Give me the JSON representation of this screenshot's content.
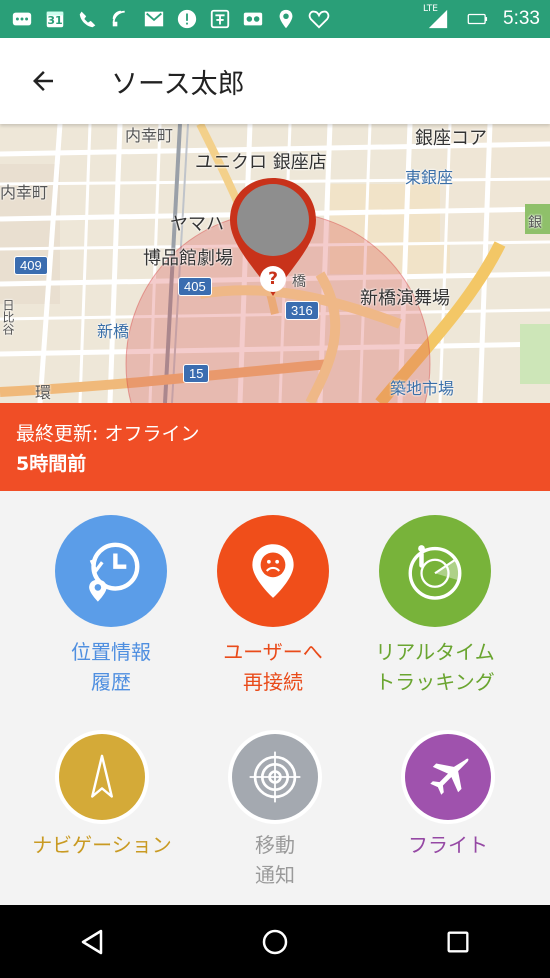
{
  "status_bar": {
    "time": "5:33",
    "calendar_day": "31",
    "lte": "LTE",
    "icons": [
      "notification-icon",
      "calendar-icon",
      "wifi-call-icon",
      "nfc-icon",
      "mail-icon",
      "alert-icon",
      "app-icon",
      "voicemail-icon",
      "location-icon",
      "heart-icon",
      "signal-icon",
      "battery-icon"
    ]
  },
  "app_bar": {
    "title": "ソース太郎"
  },
  "map": {
    "labels": {
      "uchisaiwaicho_top": "内幸町",
      "uchisaiwaicho_left": "内幸町",
      "ginza_core": "銀座コア",
      "uniqlo": "ユニクロ 銀座店",
      "higashi_ginza": "東銀座",
      "yamaha": "ヤマハ",
      "hakuhinkan": "博品館劇場",
      "shinbashi_enbujo": "新橋演舞場",
      "shinbashi": "新橋",
      "tsukiji": "築地市場",
      "ginza_right": "銀",
      "hibiya": "日比谷",
      "hashi": "橋",
      "kan": "環"
    },
    "shields": {
      "r409": "409",
      "r405": "405",
      "r316": "316",
      "r15": "15"
    },
    "pin_badge": "?"
  },
  "status": {
    "line1": "最終更新: オフライン",
    "line2": "5時間前"
  },
  "actions": [
    {
      "label1": "位置情報",
      "label2": "履歴",
      "color": "#5b9de8",
      "text_color": "#4f8fe0"
    },
    {
      "label1": "ユーザーへ",
      "label2": "再接続",
      "color": "#f04e1a",
      "text_color": "#e94b1a"
    },
    {
      "label1": "リアルタイム",
      "label2": "トラッキング",
      "color": "#78b33a",
      "text_color": "#6aa530"
    },
    {
      "label1": "ナビゲーション",
      "label2": "",
      "color": "#d4aa38",
      "text_color": "#c99a22"
    },
    {
      "label1": "移動",
      "label2": "通知",
      "color": "#a4a9b0",
      "text_color": "#9a9a9a"
    },
    {
      "label1": "フライト",
      "label2": "",
      "color": "#9f52ad",
      "text_color": "#9548a4"
    }
  ],
  "nav": {
    "back": "back-nav",
    "home": "home-nav",
    "recents": "recents-nav"
  }
}
